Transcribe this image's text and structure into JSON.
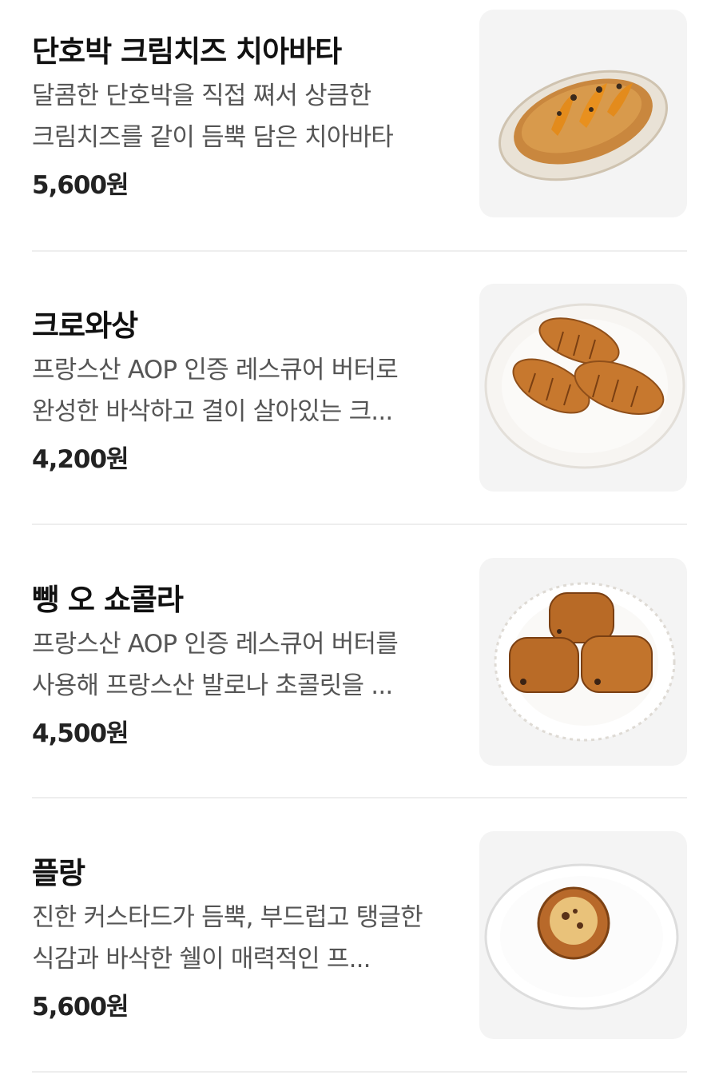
{
  "menu_items": [
    {
      "name": "단호박 크림치즈 치아바타",
      "description": "달콤한 단호박을 직접 쪄서 상큼한 크림치즈를 같이 듬뿍 담은 치아바타",
      "price": "5,600원",
      "image_icon": "ciabatta-icon"
    },
    {
      "name": "크로와상",
      "description": "프랑스산 AOP 인증 레스큐어 버터로 완성한 바삭하고 결이 살아있는 크...",
      "price": "4,200원",
      "image_icon": "croissant-icon"
    },
    {
      "name": "뺑 오 쇼콜라",
      "description": "프랑스산 AOP 인증 레스큐어 버터를 사용해 프랑스산 발로나 초콜릿을 ...",
      "price": "4,500원",
      "image_icon": "pain-au-chocolat-icon"
    },
    {
      "name": "플랑",
      "description": "진한 커스타드가 듬뿍, 부드럽고 탱글한 식감과 바삭한 쉘이 매력적인 프...",
      "price": "5,600원",
      "image_icon": "flan-icon"
    }
  ]
}
